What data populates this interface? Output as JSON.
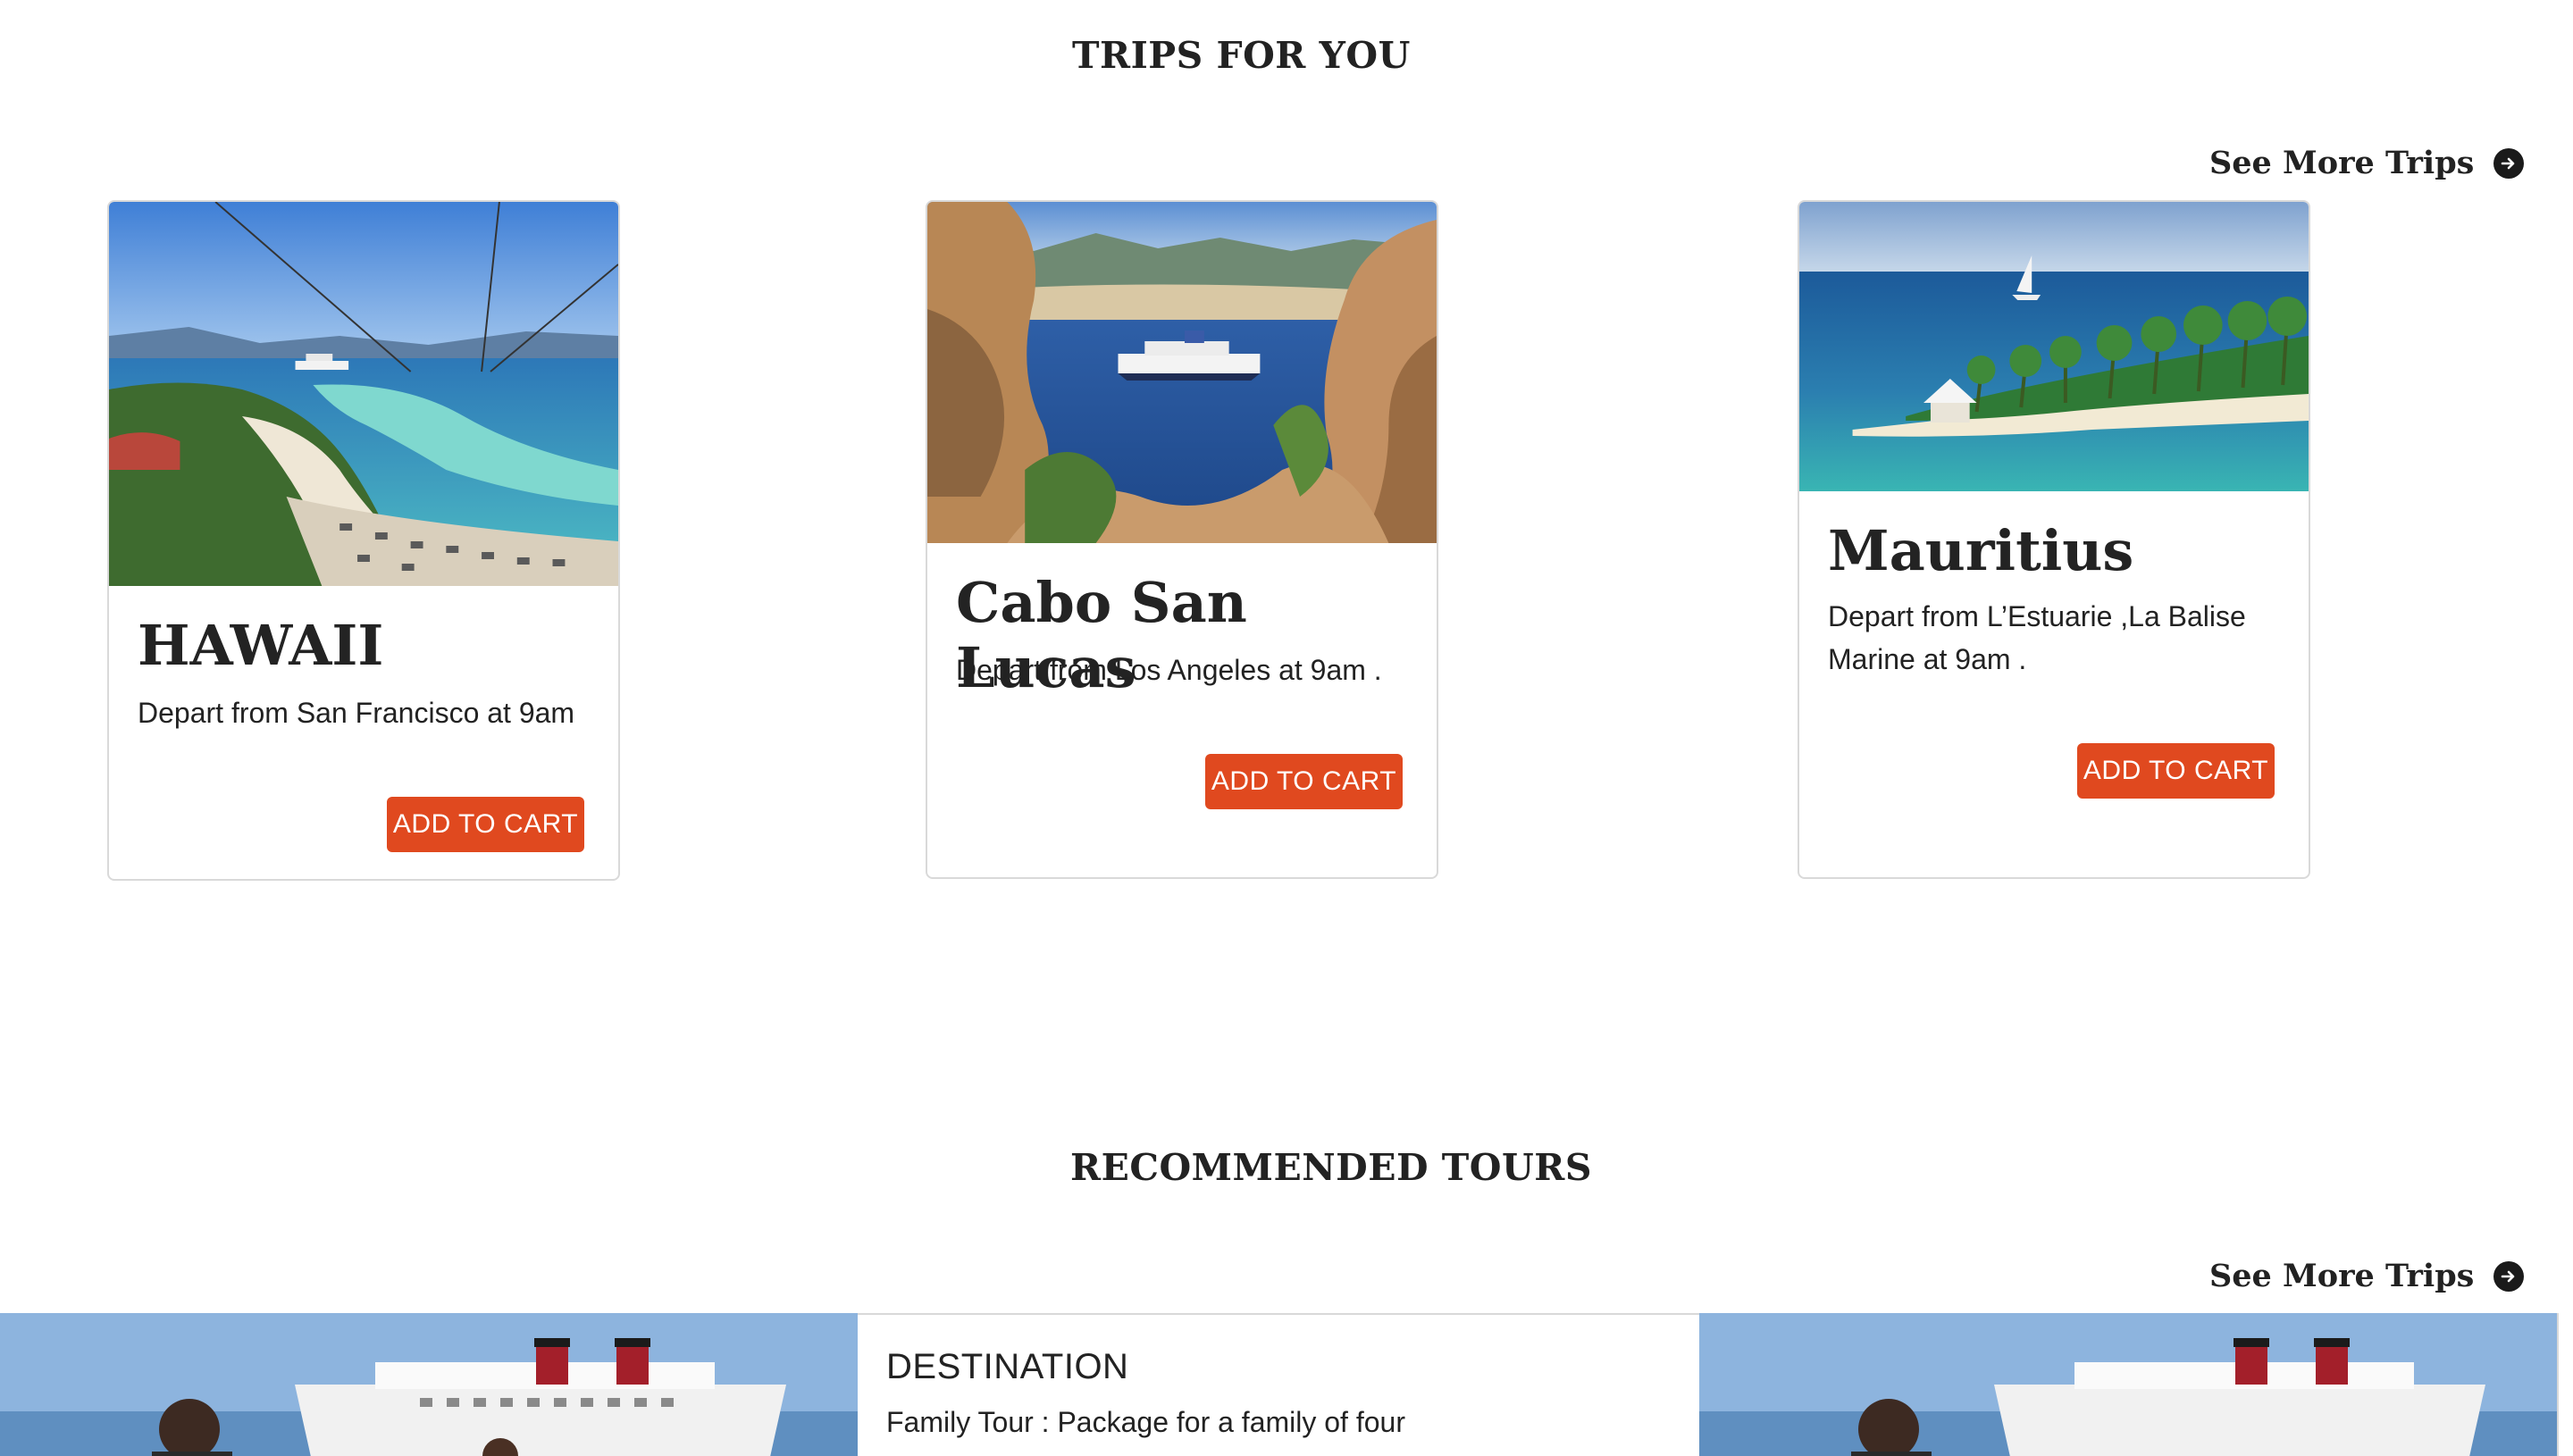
{
  "trips_section": {
    "title": "TRIPS FOR YOU",
    "see_more": "See More Trips",
    "cards": [
      {
        "title": "HAWAII",
        "description": "Depart from San Francisco at 9am",
        "button": "ADD TO CART"
      },
      {
        "title": "Cabo San Lucas",
        "description": "Depart from Los Angeles at 9am .",
        "button": "ADD TO CART"
      },
      {
        "title": "Mauritius",
        "description": "Depart from L’Estuarie ,La Balise Marine at 9am .",
        "button": "ADD TO CART"
      }
    ]
  },
  "tours_section": {
    "title": "RECOMMENDED TOURS",
    "see_more": "See More Trips",
    "tour": {
      "heading": "DESTINATION",
      "description": "Family Tour : Package for a family of four"
    }
  },
  "icons": {
    "see_more": "arrow-right-circle-icon"
  },
  "colors": {
    "accent": "#e0491f",
    "border": "#d9d9d9",
    "text": "#222222"
  }
}
